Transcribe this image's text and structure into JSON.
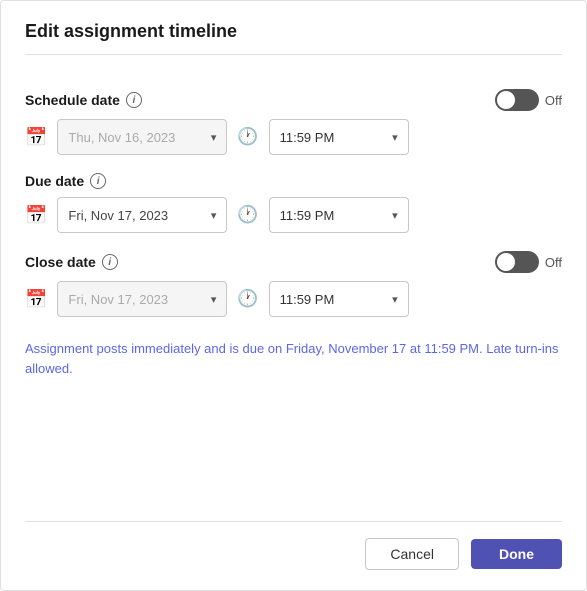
{
  "dialog": {
    "title": "Edit assignment timeline"
  },
  "schedule": {
    "label": "Schedule date",
    "toggle_label": "Off",
    "toggle_on": false,
    "date_placeholder": "Thu, Nov 16, 2023",
    "date_disabled": true,
    "time_value": "11:59 PM"
  },
  "due": {
    "label": "Due date",
    "date_value": "Fri, Nov 17, 2023",
    "date_disabled": false,
    "time_value": "11:59 PM"
  },
  "close": {
    "label": "Close date",
    "toggle_label": "Off",
    "toggle_on": false,
    "date_placeholder": "Fri, Nov 17, 2023",
    "date_disabled": true,
    "time_value": "11:59 PM"
  },
  "info_text": "Assignment posts immediately and is due on Friday, November 17 at 11:59 PM. Late turn-ins allowed.",
  "icons": {
    "info": "i",
    "calendar": "📅",
    "clock": "🕐",
    "chevron": "▾"
  },
  "buttons": {
    "cancel": "Cancel",
    "done": "Done"
  }
}
